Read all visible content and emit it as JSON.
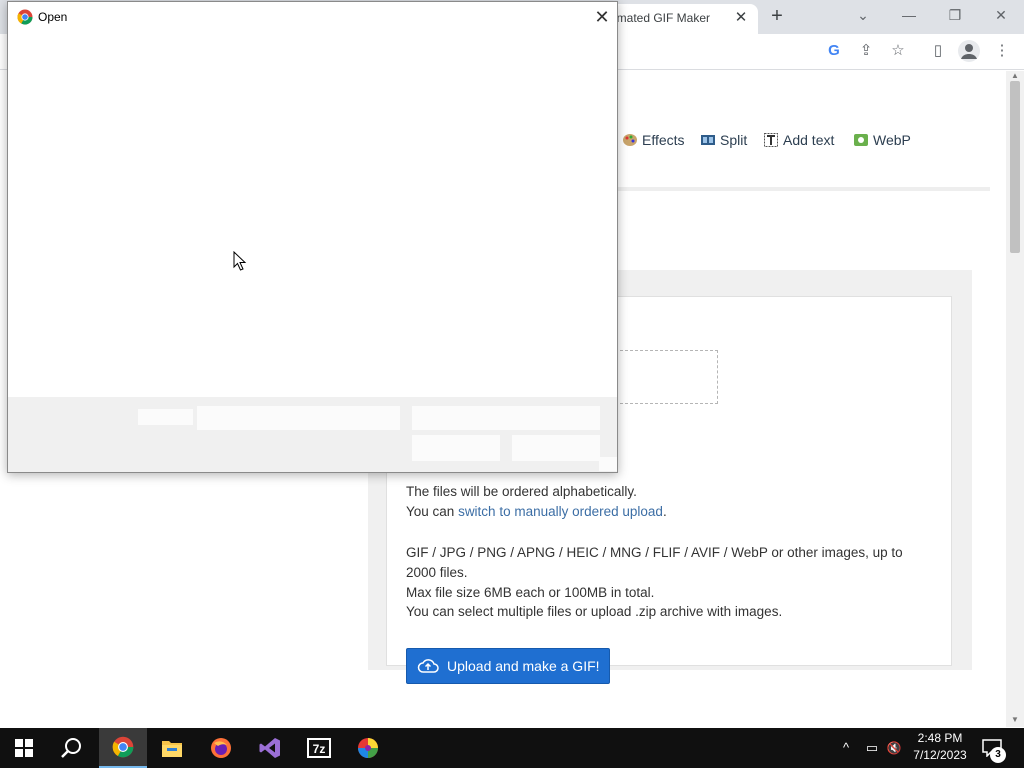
{
  "browser": {
    "tab_title": "imated GIF Maker",
    "tab_close": "✕",
    "new_tab": "+",
    "window_controls": {
      "tab_search": "⌄",
      "minimize": "—",
      "restore": "❐",
      "close": "✕"
    },
    "toolbar_icons": {
      "google": "G",
      "share": "⇪",
      "bookmark": "☆",
      "side_panel": "▯",
      "profile": "●",
      "menu": "⋮"
    }
  },
  "page": {
    "menu": [
      {
        "label": "Effects",
        "icon": "palette-icon"
      },
      {
        "label": "Split",
        "icon": "film-split-icon"
      },
      {
        "label": "Add text",
        "icon": "text-icon"
      },
      {
        "label": "WebP",
        "icon": "webp-icon"
      }
    ],
    "info": {
      "line1": "The files will be ordered alphabetically.",
      "line2_prefix": "You can ",
      "line2_link": "switch to manually ordered upload",
      "line2_suffix": ".",
      "line3": "GIF / JPG / PNG / APNG / HEIC / MNG / FLIF / AVIF / WebP or other images, up to",
      "line4": "2000 files.",
      "line5": "Max file size 6MB each or 100MB in total.",
      "line6": "You can select multiple files or upload .zip archive with images."
    },
    "upload_button": "Upload and make a GIF!"
  },
  "dialog": {
    "title": "Open",
    "close": "✕"
  },
  "taskbar": {
    "apps": [
      "start-icon",
      "search-icon",
      "chrome-icon",
      "file-explorer-icon",
      "firefox-icon",
      "visual-studio-icon",
      "7zip-icon",
      "color-app-icon"
    ],
    "time": "2:48 PM",
    "date": "7/12/2023",
    "notification_count": "3",
    "tray": {
      "chevron": "^",
      "network": "▭",
      "volume": "🔇"
    }
  },
  "colors": {
    "accent_button": "#1f6fd1",
    "link": "#3c6ea5",
    "taskbar": "#101010"
  }
}
